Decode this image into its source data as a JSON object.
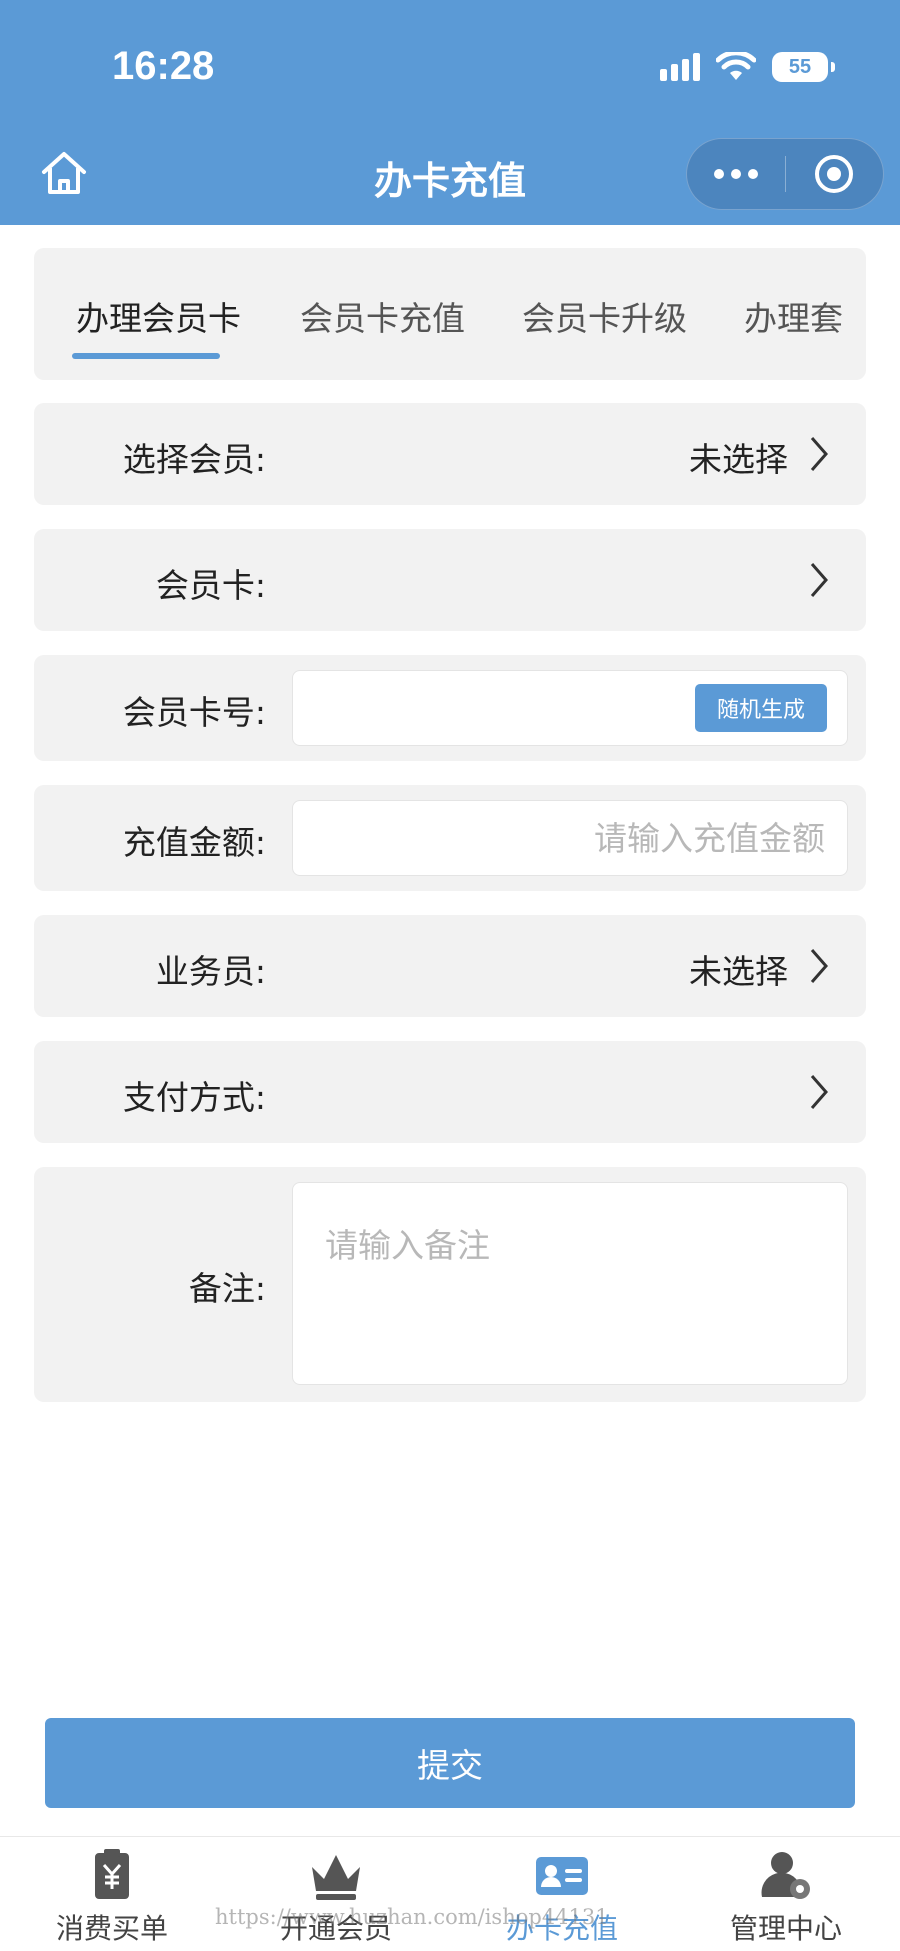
{
  "status_bar": {
    "time": "16:28",
    "battery": "55"
  },
  "header": {
    "title": "办卡充值"
  },
  "tabs": [
    {
      "label": "办理会员卡",
      "active": true
    },
    {
      "label": "会员卡充值",
      "active": false
    },
    {
      "label": "会员卡升级",
      "active": false
    },
    {
      "label": "办理套",
      "active": false
    }
  ],
  "form": {
    "select_member": {
      "label": "选择会员:",
      "value": "未选择"
    },
    "member_card": {
      "label": "会员卡:",
      "value": ""
    },
    "card_number": {
      "label": "会员卡号:",
      "value": "",
      "placeholder": "",
      "button": "随机生成"
    },
    "recharge_amount": {
      "label": "充值金额:",
      "value": "",
      "placeholder": "请输入充值金额"
    },
    "salesperson": {
      "label": "业务员:",
      "value": "未选择"
    },
    "payment_method": {
      "label": "支付方式:",
      "value": ""
    },
    "remark": {
      "label": "备注:",
      "value": "",
      "placeholder": "请输入备注"
    }
  },
  "submit_label": "提交",
  "bottom_nav": [
    {
      "label": "消费买单",
      "icon": "receipt-yen-icon",
      "active": false
    },
    {
      "label": "开通会员",
      "icon": "crown-icon",
      "active": false
    },
    {
      "label": "办卡充值",
      "icon": "id-card-icon",
      "active": true
    },
    {
      "label": "管理中心",
      "icon": "user-gear-icon",
      "active": false
    }
  ],
  "watermark": "https://www.huzhan.com/ishop44131",
  "colors": {
    "primary": "#5b9ad6",
    "row_bg": "#f2f2f2",
    "placeholder": "#b8b8b8"
  }
}
